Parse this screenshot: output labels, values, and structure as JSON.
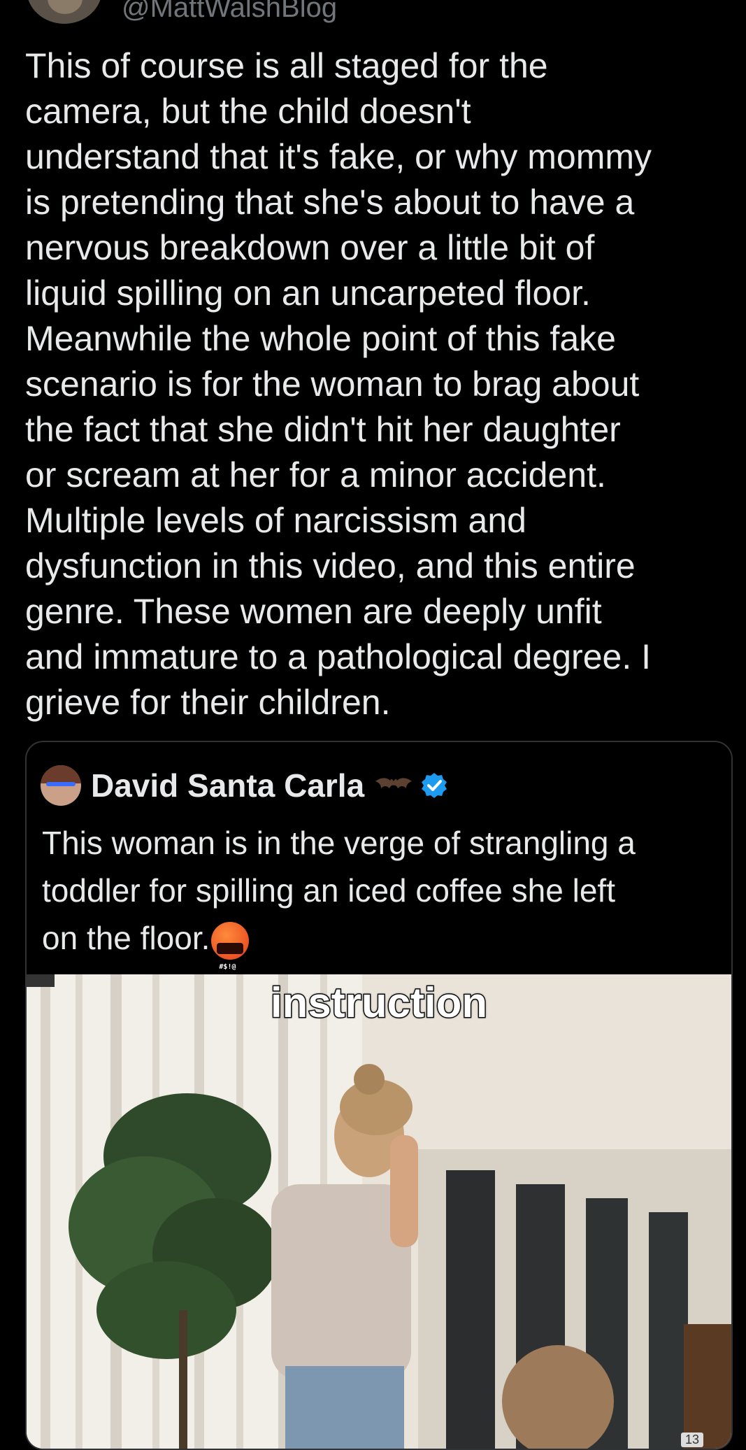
{
  "author": {
    "handle": "@MattWalshBlog"
  },
  "tweet": {
    "text": "This of course is all staged for the\ncamera, but the child doesn't\nunderstand that it's fake, or why mommy\nis pretending that she's about to have a\nnervous breakdown over a little bit of\nliquid spilling on an uncarpeted floor.\nMeanwhile the whole point of this fake\nscenario is for the woman to brag about\nthe fact that she didn't hit her daughter\nor scream at her for a minor accident.\nMultiple levels of narcissism and\ndysfunction in this video, and this entire\ngenre. These women are deeply unfit\nand immature to a pathological degree. I\ngrieve for their children."
  },
  "quoted_tweet": {
    "name": "David Santa Carla",
    "name_emoji_icon": "bat-icon",
    "verified_icon": "verified-badge-icon",
    "text": "This woman is in the verge of strangling a\ntoddler for spilling an iced coffee she left\non the floor.",
    "trailing_emoji_icon": "face-with-symbols-on-mouth-icon",
    "emoji_symbols": "#$!@",
    "media": {
      "caption": "instruction",
      "counter": "13"
    }
  },
  "colors": {
    "background": "#000000",
    "text": "#e7e9ea",
    "muted": "#71767b",
    "border": "#2f3336",
    "verified": "#1d9bf0"
  }
}
